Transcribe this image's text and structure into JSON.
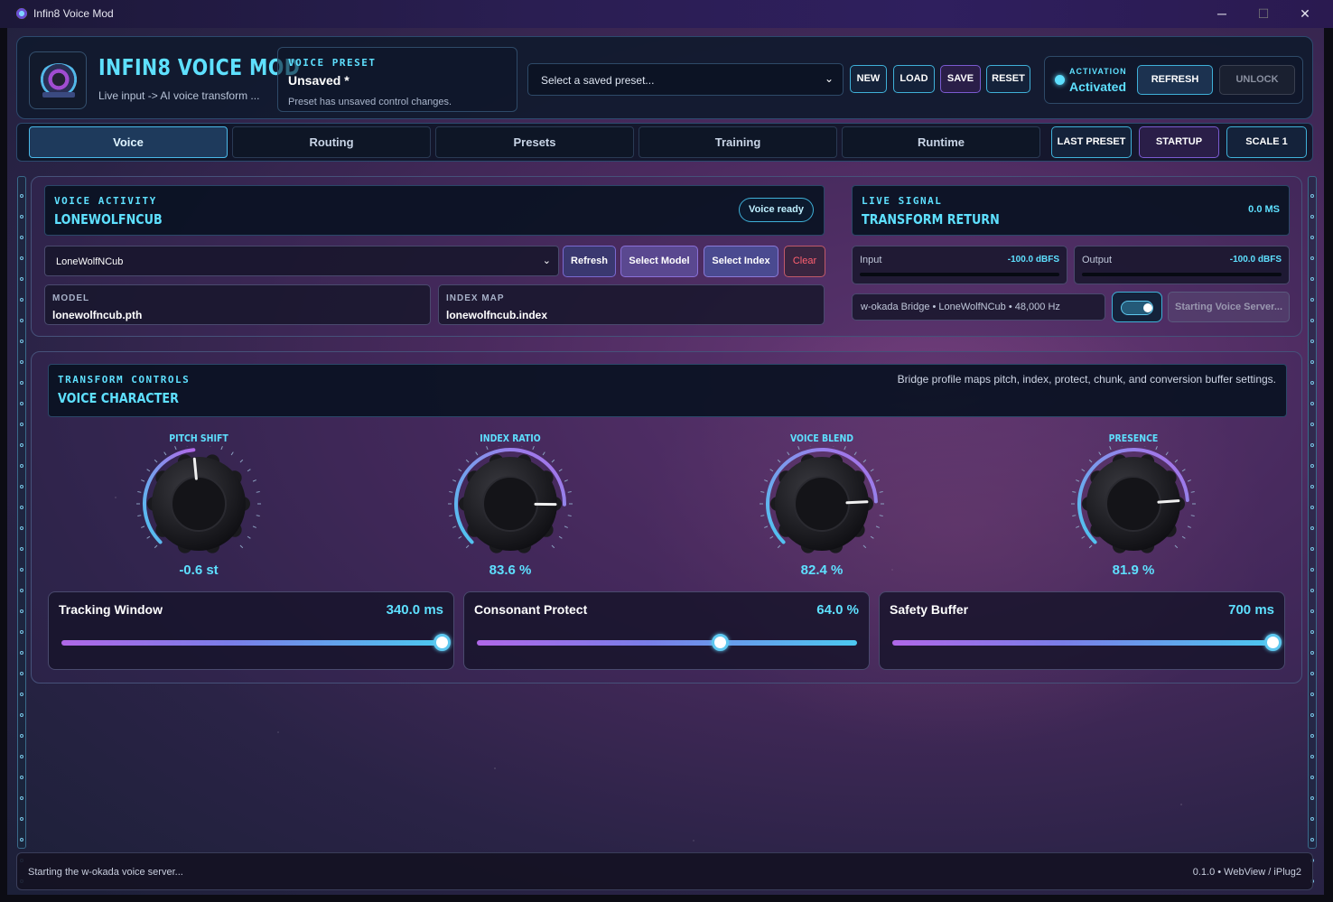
{
  "window": {
    "title": "Infin8 Voice Mod",
    "minimize": "─",
    "maximize": "☐",
    "close": "✕"
  },
  "header": {
    "app_title": "INFIN8 VOICE MOD",
    "app_subtitle": "Live input -> AI voice transform ...",
    "preset_kicker": "VOICE PRESET",
    "preset_name": "Unsaved *",
    "preset_note": "Preset has unsaved control changes.",
    "preset_select_placeholder": "Select a saved preset...",
    "btn_new": "NEW",
    "btn_load": "LOAD",
    "btn_save": "SAVE",
    "btn_reset": "RESET",
    "activation_label": "ACTIVATION",
    "activation_value": "Activated",
    "btn_refresh": "REFRESH",
    "btn_unlock": "UNLOCK"
  },
  "tabs": {
    "items": [
      "Voice",
      "Routing",
      "Presets",
      "Training",
      "Runtime"
    ],
    "active": "Voice",
    "btn_last_preset": "LAST PRESET",
    "btn_startup": "STARTUP",
    "btn_scale": "SCALE 1"
  },
  "voice_activity": {
    "kicker": "VOICE ACTIVITY",
    "title": "LONEWOLFNCUB",
    "badge": "Voice ready",
    "model_select": "LoneWolfNCub",
    "btn_refresh": "Refresh",
    "btn_select_model": "Select Model",
    "btn_select_index": "Select Index",
    "btn_clear": "Clear",
    "model_label": "MODEL",
    "model_value": "lonewolfncub.pth",
    "index_label": "INDEX MAP",
    "index_value": "lonewolfncub.index"
  },
  "live_signal": {
    "kicker": "LIVE SIGNAL",
    "title": "TRANSFORM RETURN",
    "latency": "0.0 MS",
    "input_label": "Input",
    "input_value": "-100.0 dBFS",
    "output_label": "Output",
    "output_value": "-100.0 dBFS",
    "bridge_info": "w-okada Bridge • LoneWolfNCub • 48,000 Hz",
    "start_button": "Starting Voice Server...",
    "toggle_on": true
  },
  "transform": {
    "kicker": "TRANSFORM CONTROLS",
    "title": "VOICE CHARACTER",
    "note": "Bridge profile maps pitch, index, protect, chunk, and conversion buffer settings."
  },
  "knobs": [
    {
      "label": "PITCH SHIFT",
      "value_text": "-0.6 st",
      "fraction": 0.48
    },
    {
      "label": "INDEX RATIO",
      "value_text": "83.6 %",
      "fraction": 0.836
    },
    {
      "label": "VOICE BLEND",
      "value_text": "82.4 %",
      "fraction": 0.824
    },
    {
      "label": "PRESENCE",
      "value_text": "81.9 %",
      "fraction": 0.819
    }
  ],
  "sliders": [
    {
      "label": "Tracking Window",
      "value_text": "340.0 ms",
      "fraction": 1.0
    },
    {
      "label": "Consonant Protect",
      "value_text": "64.0 %",
      "fraction": 0.64
    },
    {
      "label": "Safety Buffer",
      "value_text": "700 ms",
      "fraction": 1.0
    }
  ],
  "status": {
    "left": "Starting the w-okada voice server...",
    "right": "0.1.0 • WebView / iPlug2"
  },
  "colors": {
    "accent": "#5ee0ff",
    "purple": "#b068e8",
    "clear_red": "#ff6070"
  }
}
